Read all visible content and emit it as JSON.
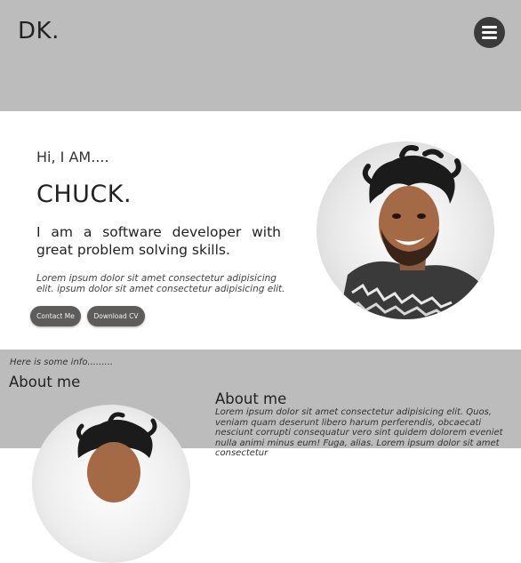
{
  "header": {
    "logo": "DK.",
    "menu_icon": "hamburger-menu-icon"
  },
  "hero": {
    "greeting": "Hi, I AM....",
    "name": "CHUCK.",
    "tagline": "I am a software developer with great problem solving skills.",
    "blurb": "Lorem ipsum dolor sit amet consectetur adipisicing elit. ipsum dolor sit amet consectetur adipisicing elit.",
    "contact_label": "Contact Me",
    "download_label": "Download CV",
    "photo": "profile-photo"
  },
  "about": {
    "info": "Here is some info.........",
    "heading_left": "About me",
    "heading_right": "About me",
    "paragraph": "Lorem ipsum dolor sit amet consectetur adipisicing elit. Quos, veniam quam deserunt libero harum perferendis, obcaecati nesciunt corrupti consequatur vero sint quidem dolorem eveniet nulla animi minus eum! Fuga, alias. Lorem ipsum dolor sit amet consectetur"
  },
  "colors": {
    "band_gray": "#bcbcbc",
    "button_gray": "#5e5b5b",
    "menu_dark": "#3a3a3a"
  }
}
